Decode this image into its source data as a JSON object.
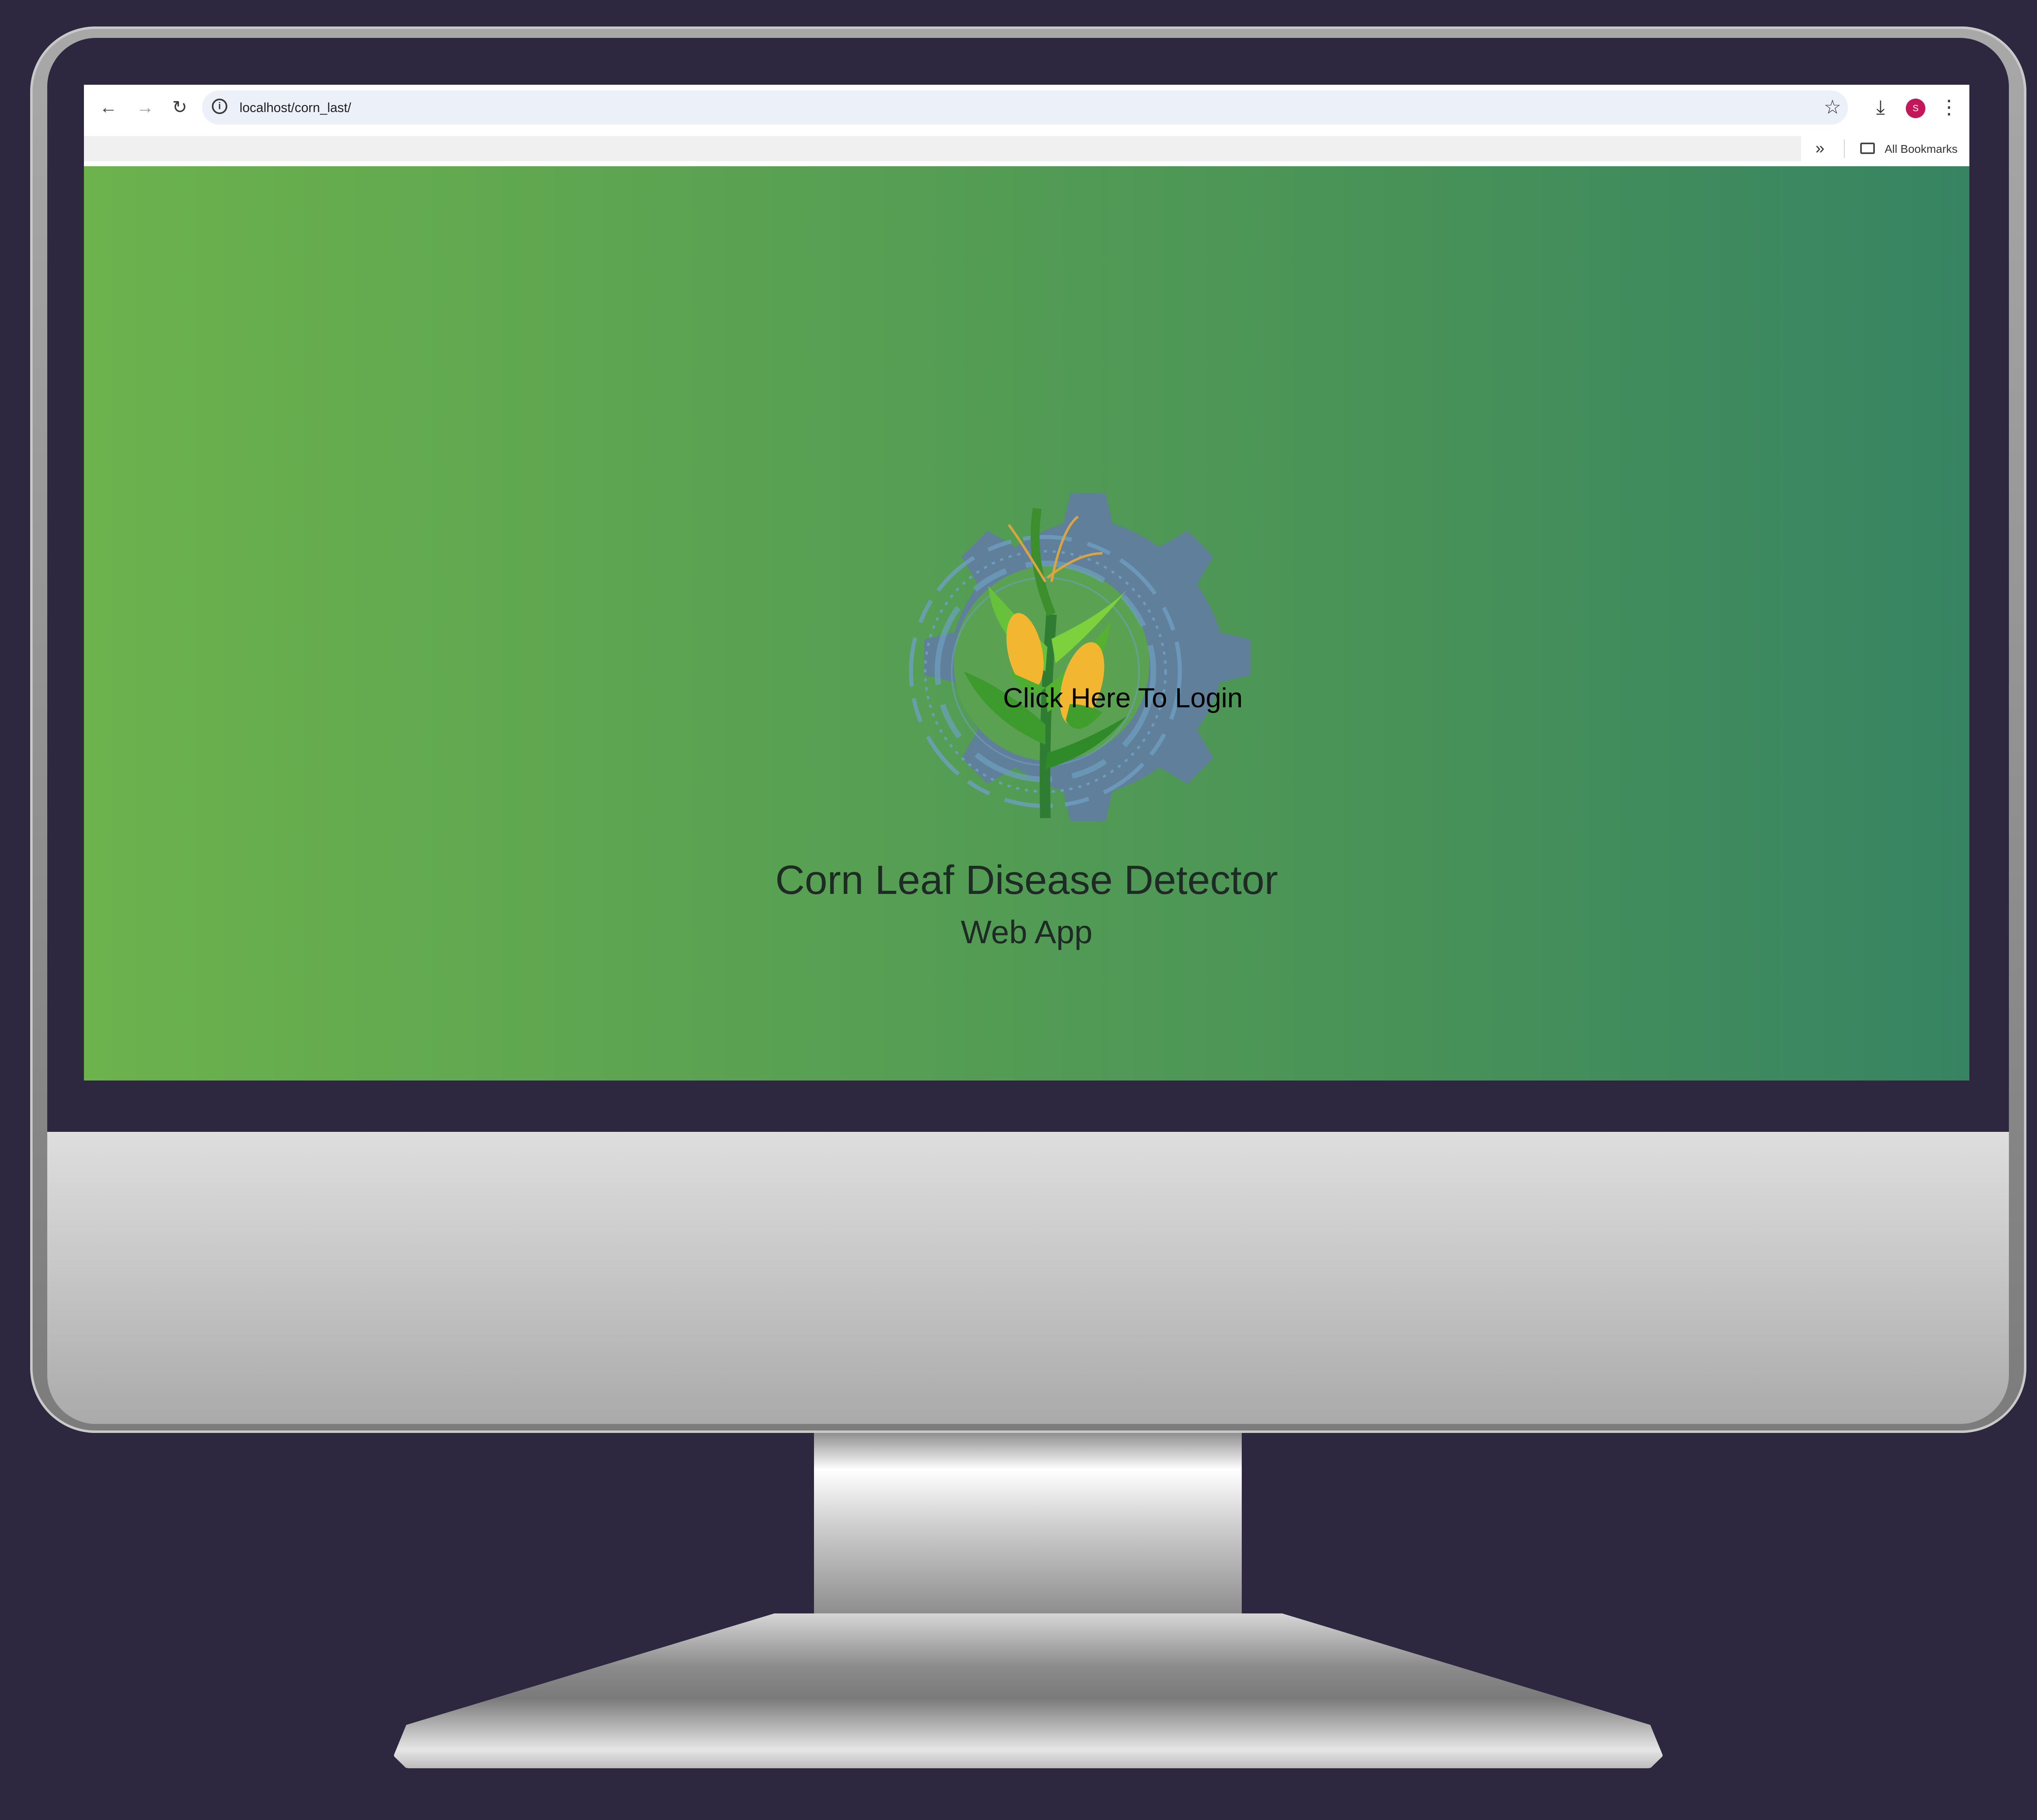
{
  "browser": {
    "url": "localhost/corn_last/",
    "avatar_letter": "S",
    "bookmarks_label": "All Bookmarks",
    "more_bookmarks": "»"
  },
  "page": {
    "login_link": "Click Here To Login",
    "title": "Corn Leaf Disease Detector",
    "subtitle": "Web App"
  },
  "colors": {
    "gradient_start": "#6cb24d",
    "gradient_end": "#378463",
    "gear": "#5f7f9a",
    "avatar": "#c2185b",
    "background": "#2d2840"
  },
  "icons": [
    "back-icon",
    "forward-icon",
    "reload-icon",
    "info-icon",
    "star-icon",
    "download-icon",
    "menu-icon",
    "folder-icon",
    "gear-icon",
    "corn-plant-icon"
  ]
}
